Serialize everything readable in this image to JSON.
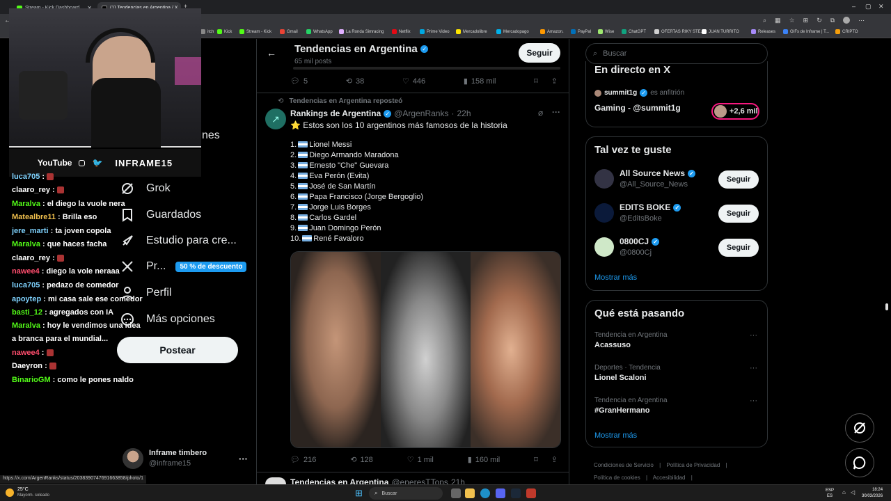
{
  "browser": {
    "tabs": [
      {
        "label": "Stream - Kick Dashboard",
        "active": false
      },
      {
        "label": "(1) Tendencias en Argentina / X",
        "active": true
      }
    ],
    "bookmarks": [
      "itch",
      "Kick",
      "Stream - Kick",
      "Gmail",
      "WhatsApp",
      "La Ronda Simracing",
      "Netflix",
      "Prime Video",
      "Mercadolibre",
      "Mercadopago",
      "Amazon.",
      "PayPal",
      "Wise",
      "ChatGPT",
      "OFERTAS RIKY STE...",
      "JUAN TURRITO",
      "Releases",
      "GIFs de Inframe | T...",
      "CRIPTO"
    ],
    "status_url": "https://x.com/ArgenRanks/status/2038390747691663858/photo/1"
  },
  "overlay": {
    "brand": "YouTube",
    "handle": "INFRAME15",
    "partial_nav": "nes"
  },
  "chat": [
    {
      "user": "luca705",
      "color": "#7fd3ff",
      "msg": ""
    },
    {
      "user": "claaro_rey",
      "color": "#ffffff",
      "msg": ""
    },
    {
      "user": "Maralva",
      "color": "#53fc18",
      "msg": "el diego la vuole nera"
    },
    {
      "user": "Matealbre11",
      "color": "#f2c14e",
      "msg": "Brilla eso"
    },
    {
      "user": "jere_marti",
      "color": "#7fd3ff",
      "msg": "ta joven copola"
    },
    {
      "user": "Maralva",
      "color": "#53fc18",
      "msg": "que haces facha"
    },
    {
      "user": "claaro_rey",
      "color": "#ffffff",
      "msg": ""
    },
    {
      "user": "nawee4",
      "color": "#ff4d6d",
      "msg": "diego la vole neraaa"
    },
    {
      "user": "luca705",
      "color": "#7fd3ff",
      "msg": "pedazo de comedor"
    },
    {
      "user": "apoytep",
      "color": "#7fd3ff",
      "msg": "mi casa sale ese comedor"
    },
    {
      "user": "basti_12",
      "color": "#53fc18",
      "msg": "agregados con IA"
    },
    {
      "user": "Maralva",
      "color": "#53fc18",
      "msg": "hoy le vendimos una idea"
    },
    {
      "user": "",
      "color": "#ffffff",
      "msg": "a branca para el mundial..."
    },
    {
      "user": "nawee4",
      "color": "#ff4d6d",
      "msg": ""
    },
    {
      "user": "Daeyron",
      "color": "#ffffff",
      "msg": ""
    },
    {
      "user": "BinarioGM",
      "color": "#53fc18",
      "msg": "como le pones naldo"
    }
  ],
  "nav": {
    "items": [
      {
        "label": "Grok",
        "icon": "grok-icon"
      },
      {
        "label": "Guardados",
        "icon": "bookmark-icon"
      },
      {
        "label": "Estudio para cre...",
        "icon": "rocket-icon"
      },
      {
        "label": "Pr...",
        "icon": "x-logo-icon"
      },
      {
        "label": "Perfil",
        "icon": "person-icon"
      },
      {
        "label": "Más opciones",
        "icon": "more-circle-icon"
      }
    ],
    "premium_badge": "50 % de descuento",
    "post_button": "Postear",
    "account": {
      "name": "Inframe timbero",
      "handle": "@inframe15"
    }
  },
  "header": {
    "title": "Tendencias en Argentina",
    "subtitle": "65 mil posts",
    "follow": "Seguir"
  },
  "prev_actions": {
    "replies": "5",
    "reposts": "38",
    "likes": "446",
    "views": "158 mil"
  },
  "tweet": {
    "repost_note": "Tendencias en Argentina reposteó",
    "author": "Rankings de Argentina",
    "handle": "@ArgenRanks",
    "time": "22h",
    "text": "⭐ Estos son los 10 argentinos más famosos de la historia",
    "list": [
      "1.",
      "Lionel Messi",
      "2.",
      "Diego Armando Maradona",
      "3.",
      "Ernesto \"Che\" Guevara",
      "4.",
      "Eva Perón (Evita)",
      "5.",
      "José de San Martín",
      "6.",
      "Papa Francisco (Jorge Bergoglio)",
      "7.",
      "Jorge Luis Borges",
      "8.",
      "Carlos Gardel",
      "9.",
      "Juan Domingo Perón",
      "10.",
      "René Favaloro"
    ],
    "replies": "216",
    "reposts": "128",
    "likes": "1 mil",
    "views": "160 mil"
  },
  "next_tweet": {
    "author": "Tendencias en Argentina",
    "handle": "@eneresTTops",
    "time": "21h"
  },
  "right": {
    "search_placeholder": "Buscar",
    "live": {
      "title": "En directo en X",
      "host": "summit1g",
      "host_note": "es anfitrión",
      "space": "Gaming - @summit1g",
      "listeners": "+2,6 mil"
    },
    "suggest": {
      "title": "Tal vez te guste",
      "accounts": [
        {
          "name": "All Source News",
          "handle": "@All_Source_News",
          "button": "Seguir"
        },
        {
          "name": "EDITS BOKE",
          "handle": "@EditsBoke",
          "button": "Seguir"
        },
        {
          "name": "0800CJ",
          "handle": "@0800Cj",
          "button": "Seguir"
        }
      ],
      "more": "Mostrar más"
    },
    "trends": {
      "title": "Qué está pasando",
      "items": [
        {
          "category": "Tendencia en Argentina",
          "name": "Acassuso"
        },
        {
          "category": "Deportes · Tendencia",
          "name": "Lionel Scaloni"
        },
        {
          "category": "Tendencia en Argentina",
          "name": "#GranHermano"
        }
      ],
      "more": "Mostrar más"
    },
    "footer": [
      "Condiciones de Servicio",
      "Política de Privacidad",
      "Política de cookies",
      "Accesibilidad"
    ]
  },
  "taskbar": {
    "weather_temp": "25°C",
    "weather_desc": "Mayorm. soleado",
    "search": "Buscar",
    "lang1": "ESP",
    "lang2": "ES",
    "time": "18:24",
    "date": "30/03/2026"
  }
}
